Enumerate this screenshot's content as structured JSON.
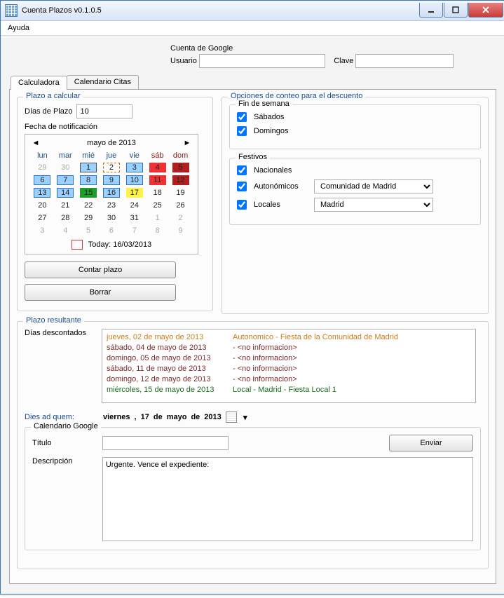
{
  "window": {
    "title": "Cuenta Plazos v0.1.0.5"
  },
  "menu": {
    "help": "Ayuda"
  },
  "google": {
    "group": "Cuenta de Google",
    "user_lbl": "Usuario",
    "pass_lbl": "Clave",
    "user_val": "",
    "pass_val": ""
  },
  "tabs": {
    "calc": "Calculadora",
    "citas": "Calendario Citas"
  },
  "plazo": {
    "legend": "Plazo a calcular",
    "dias_lbl": "Días de Plazo",
    "dias_val": "10",
    "fecha_lbl": "Fecha de notificación",
    "month": "mayo de 2013",
    "dow": [
      "lun",
      "mar",
      "mié",
      "jue",
      "vie",
      "sáb",
      "dom"
    ],
    "today_lbl": "Today: 16/03/2013",
    "btn_contar": "Contar plazo",
    "btn_borrar": "Borrar"
  },
  "calendar": {
    "rows": [
      [
        {
          "n": "29",
          "cls": "dim"
        },
        {
          "n": "30",
          "cls": "dim"
        },
        {
          "n": "1",
          "cell": "blue sel"
        },
        {
          "n": "2",
          "cell": "orange"
        },
        {
          "n": "3",
          "cell": "blue"
        },
        {
          "n": "4",
          "cell": "red"
        },
        {
          "n": "5",
          "cell": "darkred"
        }
      ],
      [
        {
          "n": "6",
          "cell": "blue"
        },
        {
          "n": "7",
          "cell": "blue"
        },
        {
          "n": "8",
          "cell": "blue"
        },
        {
          "n": "9",
          "cell": "blue"
        },
        {
          "n": "10",
          "cell": "blue"
        },
        {
          "n": "11",
          "cell": "red"
        },
        {
          "n": "12",
          "cell": "darkred"
        }
      ],
      [
        {
          "n": "13",
          "cell": "blue"
        },
        {
          "n": "14",
          "cell": "blue"
        },
        {
          "n": "15",
          "cell": "green"
        },
        {
          "n": "16",
          "cell": "blue"
        },
        {
          "n": "17",
          "cell": "yellow"
        },
        {
          "n": "18"
        },
        {
          "n": "19"
        }
      ],
      [
        {
          "n": "20"
        },
        {
          "n": "21"
        },
        {
          "n": "22"
        },
        {
          "n": "23"
        },
        {
          "n": "24"
        },
        {
          "n": "25"
        },
        {
          "n": "26"
        }
      ],
      [
        {
          "n": "27"
        },
        {
          "n": "28"
        },
        {
          "n": "29"
        },
        {
          "n": "30"
        },
        {
          "n": "31"
        },
        {
          "n": "1",
          "cls": "dim"
        },
        {
          "n": "2",
          "cls": "dim"
        }
      ],
      [
        {
          "n": "3",
          "cls": "dim"
        },
        {
          "n": "4",
          "cls": "dim"
        },
        {
          "n": "5",
          "cls": "dim"
        },
        {
          "n": "6",
          "cls": "dim"
        },
        {
          "n": "7",
          "cls": "dim"
        },
        {
          "n": "8",
          "cls": "dim"
        },
        {
          "n": "9",
          "cls": "dim"
        }
      ]
    ]
  },
  "opts": {
    "legend": "Opciones de conteo para el descuento",
    "weekend_legend": "Fin de semana",
    "sab": "Sábados",
    "dom": "Domingos",
    "fest_legend": "Festivos",
    "nac": "Nacionales",
    "aut": "Autonómicos",
    "loc": "Locales",
    "aut_sel": "Comunidad de Madrid",
    "loc_sel": "Madrid"
  },
  "result": {
    "legend": "Plazo resultante",
    "dias_desc_lbl": "Días descontados",
    "lines": [
      {
        "date": "jueves, 02 de mayo de 2013",
        "info": "Autonomico - Fiesta de la Comunidad de Madrid",
        "cls": "orange-txt"
      },
      {
        "date": "sábado, 04 de mayo de 2013",
        "info": "- <no informacion>",
        "cls": "brown-txt"
      },
      {
        "date": "domingo, 05 de mayo de 2013",
        "info": "- <no informacion>",
        "cls": "brown-txt"
      },
      {
        "date": "sábado, 11 de mayo de 2013",
        "info": "- <no informacion>",
        "cls": "brown-txt"
      },
      {
        "date": "domingo, 12 de mayo de 2013",
        "info": "- <no informacion>",
        "cls": "brown-txt"
      },
      {
        "date": "miércoles, 15 de mayo de 2013",
        "info": "Local - Madrid - Fiesta Local 1",
        "cls": "green-txt"
      }
    ],
    "dies_lbl": "Dies ad quem:",
    "dies_val": {
      "dow": "viernes",
      "sep": ",",
      "d": "17",
      "de1": "de",
      "m": "mayo",
      "de2": "de",
      "y": "2013"
    }
  },
  "gcal": {
    "legend": "Calendario Google",
    "title_lbl": "Título",
    "title_val": "",
    "desc_lbl": "Descripción",
    "desc_val": "Urgente. Vence el expediente:",
    "send": "Enviar"
  }
}
